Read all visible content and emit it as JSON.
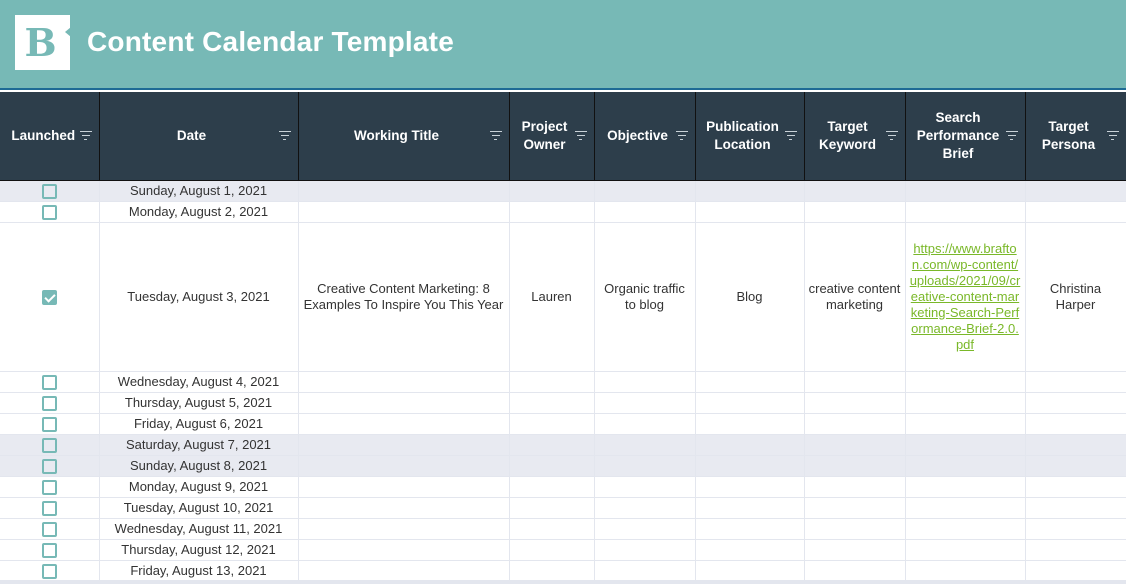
{
  "header": {
    "logo_letter": "B",
    "title": "Content Calendar Template",
    "colors": {
      "banner": "#77b9b6",
      "table_header": "#2d3e4b",
      "link": "#7ab829",
      "weekend_row": "#e8eaf1"
    }
  },
  "columns": [
    {
      "label": "Launched",
      "icon": "filter-icon"
    },
    {
      "label": "Date",
      "icon": "filter-icon"
    },
    {
      "label": "Working Title",
      "icon": "filter-icon"
    },
    {
      "label": "Project Owner",
      "icon": "filter-icon"
    },
    {
      "label": "Objective",
      "icon": "filter-icon"
    },
    {
      "label": "Publication Location",
      "icon": "filter-icon"
    },
    {
      "label": "Target Keyword",
      "icon": "filter-icon"
    },
    {
      "label": "Search Performance Brief",
      "icon": "filter-icon"
    },
    {
      "label": "Target Persona",
      "icon": "filter-icon"
    }
  ],
  "rows": [
    {
      "launched": false,
      "weekend": true,
      "date": "Sunday, August 1, 2021"
    },
    {
      "launched": false,
      "weekend": false,
      "date": "Monday, August 2, 2021"
    },
    {
      "launched": true,
      "weekend": false,
      "date": "Tuesday, August 3, 2021",
      "working_title": "Creative Content Marketing: 8 Examples To Inspire You This Year",
      "project_owner": "Lauren",
      "objective": "Organic traffic to blog",
      "publication_location": "Blog",
      "target_keyword": "creative content marketing",
      "search_performance_brief": "https://www.brafton.com/wp-content/uploads/2021/09/creative-content-marketing-Search-Performance-Brief-2.0.pdf",
      "target_persona": "Christina Harper"
    },
    {
      "launched": false,
      "weekend": false,
      "date": "Wednesday, August 4, 2021"
    },
    {
      "launched": false,
      "weekend": false,
      "date": "Thursday, August 5, 2021"
    },
    {
      "launched": false,
      "weekend": false,
      "date": "Friday, August 6, 2021"
    },
    {
      "launched": false,
      "weekend": true,
      "date": "Saturday, August 7, 2021"
    },
    {
      "launched": false,
      "weekend": true,
      "date": "Sunday, August 8, 2021"
    },
    {
      "launched": false,
      "weekend": false,
      "date": "Monday, August 9, 2021"
    },
    {
      "launched": false,
      "weekend": false,
      "date": "Tuesday, August 10, 2021"
    },
    {
      "launched": false,
      "weekend": false,
      "date": "Wednesday, August 11, 2021"
    },
    {
      "launched": false,
      "weekend": false,
      "date": "Thursday, August 12, 2021"
    },
    {
      "launched": false,
      "weekend": false,
      "date": "Friday, August 13, 2021"
    }
  ]
}
